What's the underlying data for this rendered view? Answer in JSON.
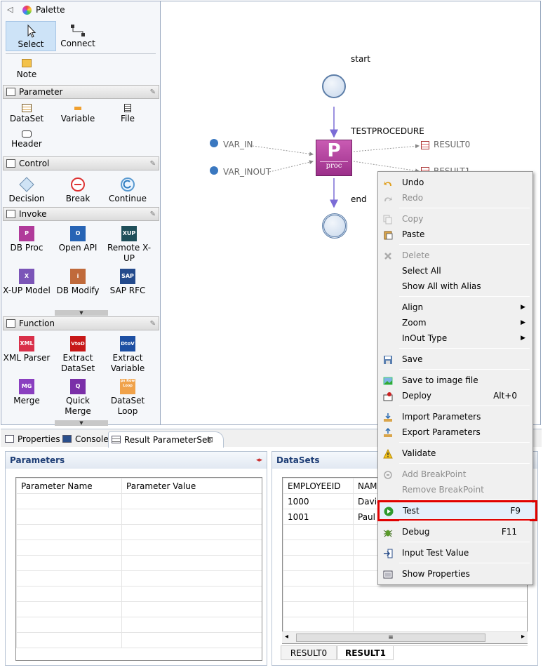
{
  "palette": {
    "title": "Palette",
    "top_tools": [
      {
        "label": "Select",
        "icon": "arrow-cursor-icon"
      },
      {
        "label": "Connect",
        "icon": "connection-icon"
      },
      {
        "label": "Note",
        "icon": "note-icon"
      }
    ],
    "sections": [
      {
        "name": "Parameter",
        "items": [
          "DataSet",
          "Variable",
          "File",
          "Header"
        ]
      },
      {
        "name": "Control",
        "items": [
          "Decision",
          "Break",
          "Continue"
        ]
      },
      {
        "name": "Invoke",
        "items": [
          "DB Proc",
          "Open API",
          "Remote X-UP",
          "X-UP Model",
          "DB Modify",
          "SAP RFC"
        ]
      },
      {
        "name": "Function",
        "items": [
          "XML Parser",
          "Extract DataSet",
          "Extract Variable",
          "Merge",
          "Quick Merge",
          "DataSet Loop"
        ]
      }
    ],
    "icon_texts": {
      "open_api": "O",
      "remote": "XUP",
      "sap": "SAP",
      "xml": "XML",
      "vtod": "VtoD",
      "dtov": "DtoV",
      "mg": "MG",
      "q": "Q",
      "loop": "ps Row Loop",
      "x": "X",
      "i": "i",
      "p": "P"
    }
  },
  "diagram": {
    "start_label": "start",
    "proc_label": "TESTPROCEDURE",
    "proc_icon_letter": "P",
    "proc_icon_text": "proc",
    "end_label": "end",
    "inputs": [
      "VAR_IN",
      "VAR_INOUT"
    ],
    "outputs": [
      "RESULT0",
      "RESULT1"
    ]
  },
  "tabs": [
    {
      "label": "Properties",
      "icon": "properties-icon"
    },
    {
      "label": "Console",
      "icon": "console-icon"
    },
    {
      "label": "Result ParameterSet",
      "icon": "table-icon",
      "close": "⊠"
    }
  ],
  "parameters_panel": {
    "title": "Parameters",
    "columns": [
      "Parameter Name",
      "Parameter Value"
    ],
    "collapse_glyph": "◂▸"
  },
  "datasets_panel": {
    "title": "DataSets",
    "columns": [
      "EMPLOYEEID",
      "NAM"
    ],
    "rows": [
      [
        "1000",
        "David"
      ],
      [
        "1001",
        "Paul"
      ]
    ],
    "result_tabs": [
      "RESULT0",
      "RESULT1"
    ],
    "active_result_tab": "RESULT1",
    "scroll_left": "◂",
    "scroll_right": "▸",
    "scroll_grip": "≡"
  },
  "context_menu": {
    "items": [
      {
        "label": "Undo",
        "enabled": true,
        "icon": "undo-icon"
      },
      {
        "label": "Redo",
        "enabled": false,
        "icon": "redo-icon"
      },
      {
        "sep": true
      },
      {
        "label": "Copy",
        "enabled": false,
        "icon": "copy-icon"
      },
      {
        "label": "Paste",
        "enabled": true,
        "icon": "paste-icon"
      },
      {
        "sep": true
      },
      {
        "label": "Delete",
        "enabled": false,
        "icon": "delete-icon"
      },
      {
        "label": "Select All",
        "enabled": true
      },
      {
        "label": "Show All with Alias",
        "enabled": true
      },
      {
        "sep": true
      },
      {
        "label": "Align",
        "enabled": true,
        "submenu": true
      },
      {
        "label": "Zoom",
        "enabled": true,
        "submenu": true
      },
      {
        "label": "InOut Type",
        "enabled": true,
        "submenu": true
      },
      {
        "sep": true
      },
      {
        "label": "Save",
        "enabled": true,
        "icon": "save-icon"
      },
      {
        "sep": true
      },
      {
        "label": "Save to image file",
        "enabled": true,
        "icon": "image-icon"
      },
      {
        "label": "Deploy",
        "enabled": true,
        "accelerator": "Alt+0",
        "icon": "deploy-icon"
      },
      {
        "sep": true
      },
      {
        "label": "Import Parameters",
        "enabled": true,
        "icon": "import-icon"
      },
      {
        "label": "Export Parameters",
        "enabled": true,
        "icon": "export-icon"
      },
      {
        "sep": true
      },
      {
        "label": "Validate",
        "enabled": true,
        "icon": "warning-icon"
      },
      {
        "sep": true
      },
      {
        "label": "Add BreakPoint",
        "enabled": false,
        "icon": "breakpoint-icon"
      },
      {
        "label": "Remove BreakPoint",
        "enabled": false
      },
      {
        "sep": true
      },
      {
        "label": "Test",
        "enabled": true,
        "accelerator": "F9",
        "icon": "run-icon",
        "highlighted": true
      },
      {
        "sep": true
      },
      {
        "label": "Debug",
        "enabled": true,
        "accelerator": "F11",
        "icon": "bug-icon"
      },
      {
        "sep": true
      },
      {
        "label": "Input Test Value",
        "enabled": true,
        "icon": "input-icon"
      },
      {
        "sep": true
      },
      {
        "label": "Show Properties",
        "enabled": true,
        "icon": "properties-icon"
      }
    ],
    "submenu_glyph": "▶",
    "highlight_color": "#e00000"
  }
}
